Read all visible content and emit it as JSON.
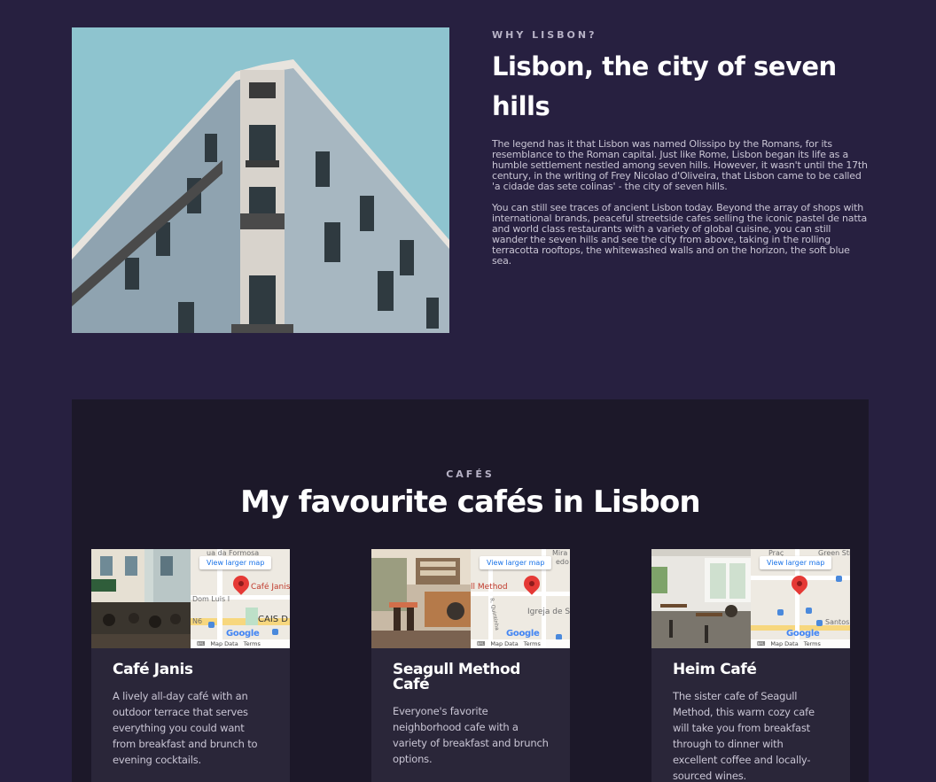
{
  "why": {
    "eyebrow": "WHY LISBON?",
    "title": "Lisbon, the city of seven hills",
    "paragraph1": "The legend has it that Lisbon was named Olissipo by the Romans, for its resemblance to the Roman capital. Just like Rome, Lisbon began its life as a humble settlement nestled among seven hills. However, it wasn't until the 17th century, in the writing of Frey Nicolao d'Oliveira, that Lisbon came to be called 'a cidade das sete colinas' - the city of seven hills.",
    "paragraph2": "You can still see traces of ancient Lisbon today. Beyond the array of shops with international brands, peaceful streetside cafes selling the iconic pastel de natta and world class restaurants with a variety of global cuisine, you can still wander the seven hills and see the city from above, taking in the rolling terracotta rooftops, the whitewashed walls and on the horizon, the soft blue sea."
  },
  "cafes": {
    "eyebrow": "CAFÉS",
    "title": "My favourite cafés in Lisbon",
    "map_link_label": "View larger map",
    "map_footer": {
      "keyboard": "⌨",
      "data": "Map Data",
      "terms": "Terms"
    },
    "map_brand": "Google",
    "items": [
      {
        "name": "Café Janis",
        "description": "A lively all-day café with an outdoor terrace that serves everything you could want from breakfast and brunch to evening cocktails.",
        "map_place": "Café Janis",
        "map_streets": [
          "ua da Formosa",
          "Dom Luis I",
          "CAIS D",
          "N6"
        ]
      },
      {
        "name": "Seagull Method Café",
        "description": "Everyone's favorite neighborhood cafe with a variety of breakfast and brunch options.",
        "map_place": "ll Method",
        "map_streets": [
          "Mira",
          "edo",
          "Igreja de S",
          "R. Quintinha"
        ]
      },
      {
        "name": "Heim Café",
        "description": "The sister cafe of Seagull Method, this warm cozy cafe will take you from breakfast through to dinner with excellent coffee and locally-sourced wines.",
        "map_place": "",
        "map_streets": [
          "Green Stre",
          "Santos",
          "Praç"
        ]
      }
    ]
  },
  "colors": {
    "page_bg": "#272040",
    "section_bg": "#1c1829",
    "card_bg": "#2a2639",
    "text_muted": "#c9c5d4",
    "pin": "#e53935"
  }
}
